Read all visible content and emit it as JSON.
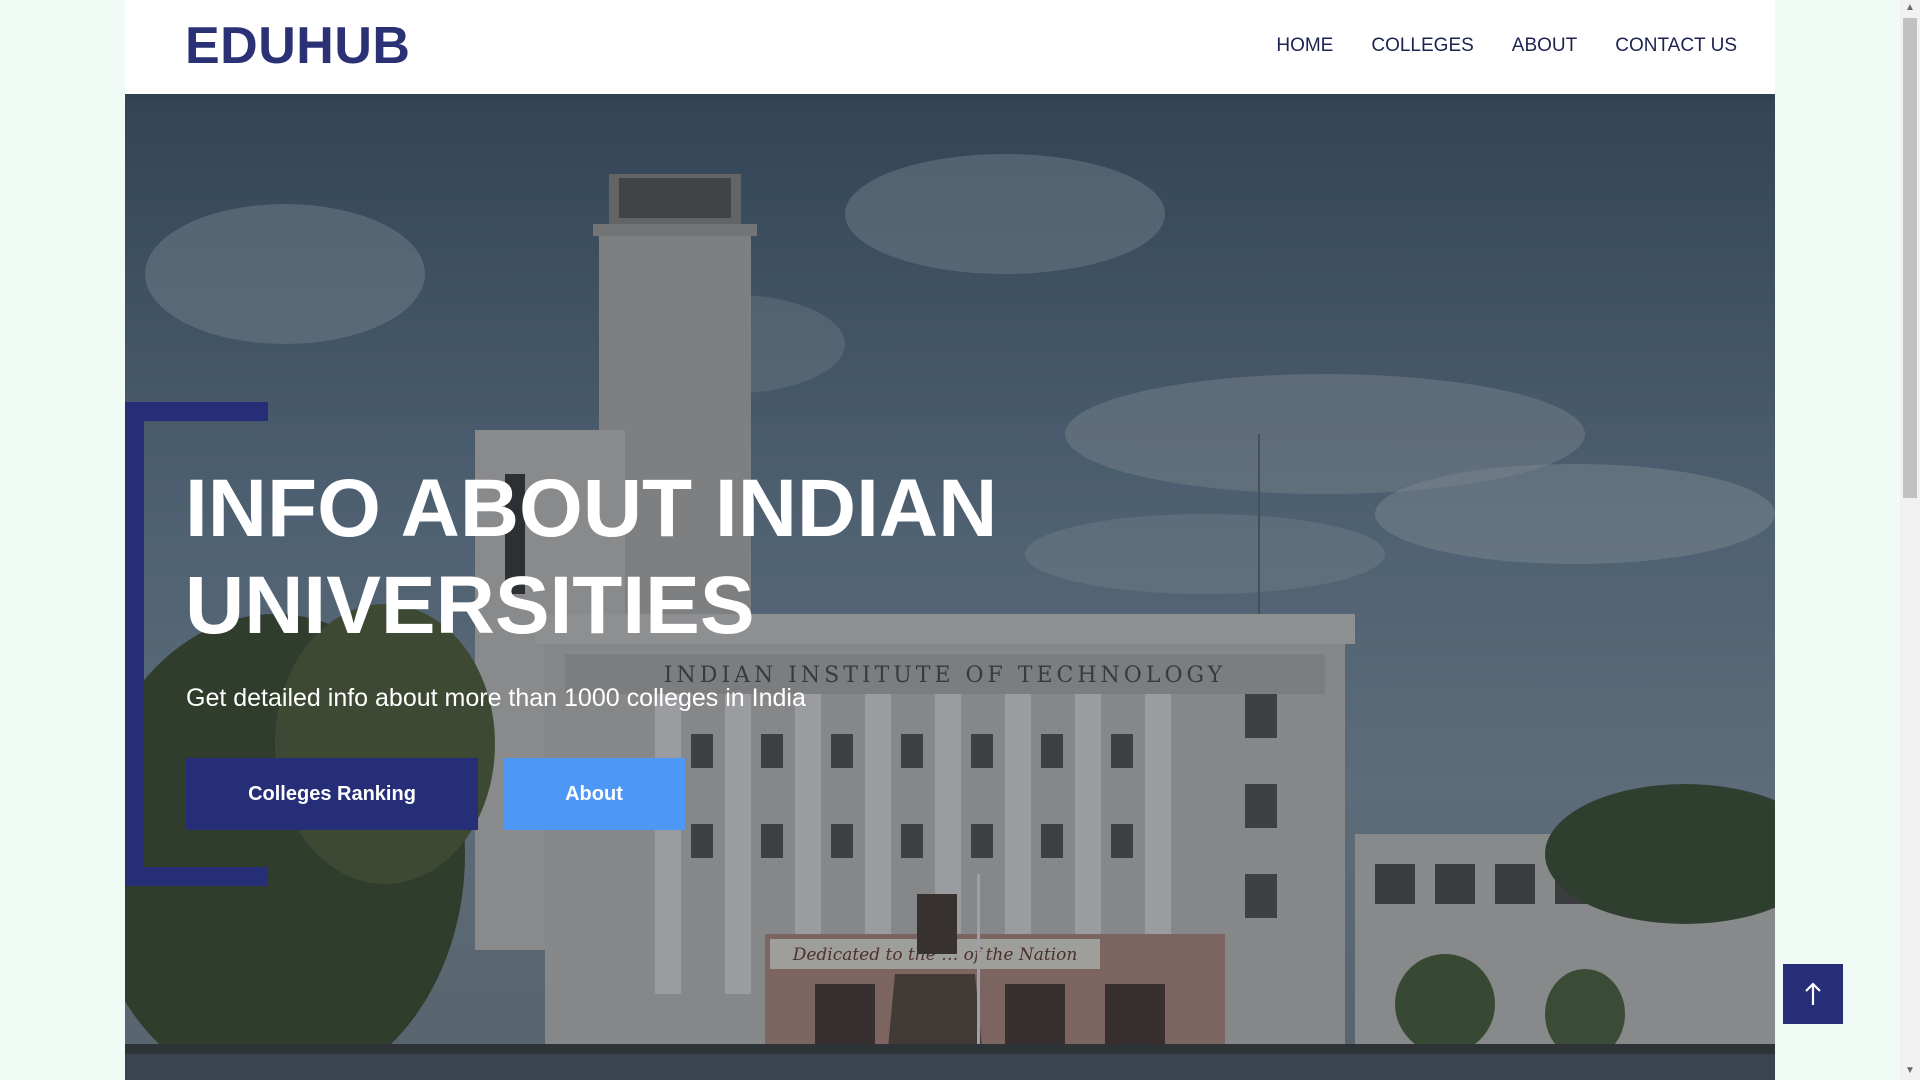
{
  "brand": {
    "logo": "EDUHUB"
  },
  "nav": {
    "items": [
      {
        "label": "HOME"
      },
      {
        "label": "COLLEGES"
      },
      {
        "label": "ABOUT"
      },
      {
        "label": "CONTACT US"
      }
    ]
  },
  "hero": {
    "title_line1": "INFO ABOUT INDIAN",
    "title_line2": "UNIVERSITIES",
    "subtitle": "Get detailed info about more than 1000 colleges in India",
    "building_sign": "INDIAN INSTITUTE OF TECHNOLOGY",
    "plaque": "Dedicated to the … of the Nation",
    "buttons": {
      "primary_label": "Colleges Ranking",
      "secondary_label": "About"
    }
  },
  "icons": {
    "scroll_top": "arrow-up-icon"
  },
  "colors": {
    "brand": "#2a3175",
    "accent_dark": "#262e78",
    "accent_light": "#4d97f6",
    "page_bg": "#f1fbf5"
  }
}
